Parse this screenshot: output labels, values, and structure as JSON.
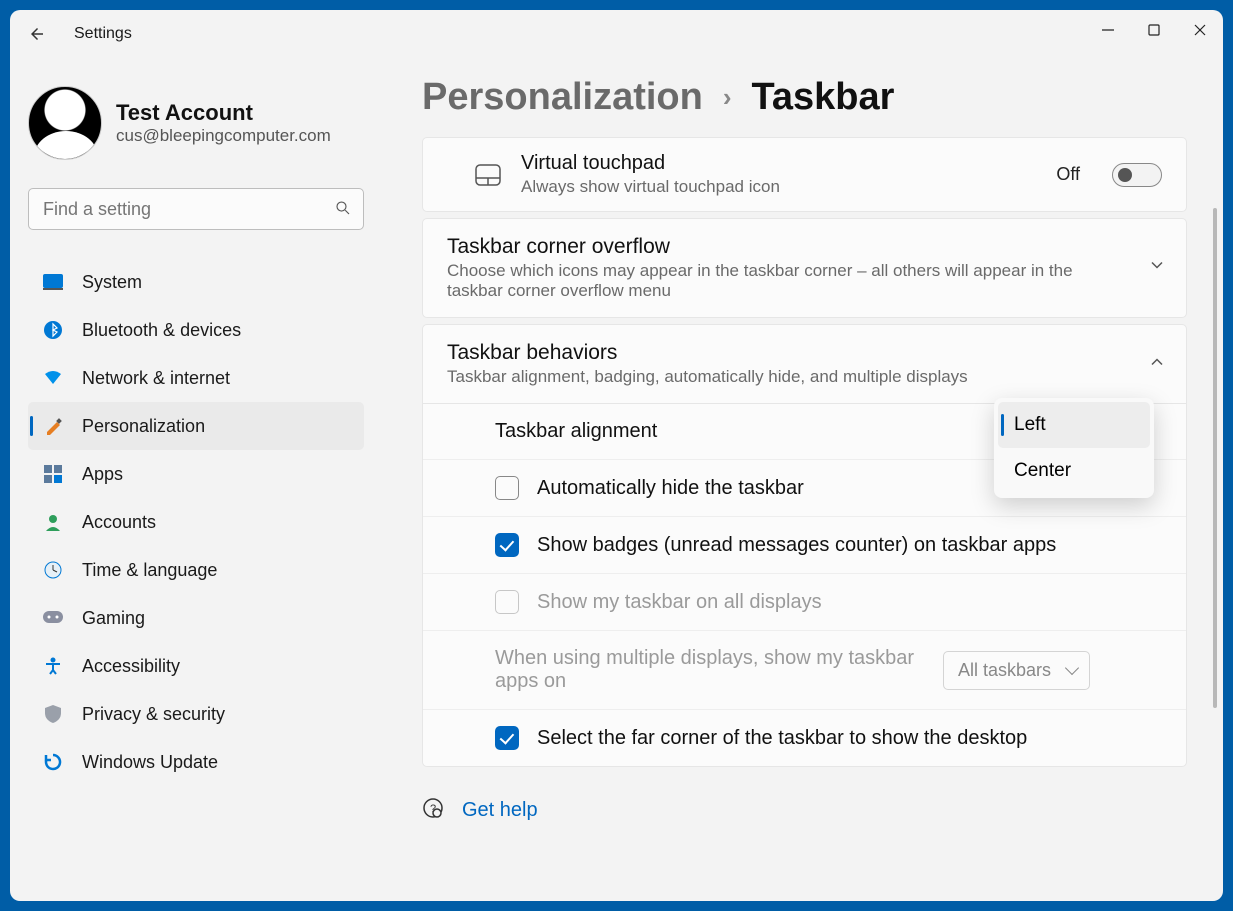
{
  "app": {
    "title": "Settings"
  },
  "window_controls": {
    "min": "—",
    "max": "▢",
    "close": "✕"
  },
  "user": {
    "name": "Test Account",
    "email": "cus@bleepingcomputer.com"
  },
  "search": {
    "placeholder": "Find a setting"
  },
  "nav": [
    {
      "label": "System",
      "icon": "system"
    },
    {
      "label": "Bluetooth & devices",
      "icon": "bluetooth"
    },
    {
      "label": "Network & internet",
      "icon": "network"
    },
    {
      "label": "Personalization",
      "icon": "personalization",
      "active": true
    },
    {
      "label": "Apps",
      "icon": "apps"
    },
    {
      "label": "Accounts",
      "icon": "accounts"
    },
    {
      "label": "Time & language",
      "icon": "time"
    },
    {
      "label": "Gaming",
      "icon": "gaming"
    },
    {
      "label": "Accessibility",
      "icon": "accessibility"
    },
    {
      "label": "Privacy & security",
      "icon": "privacy"
    },
    {
      "label": "Windows Update",
      "icon": "update"
    }
  ],
  "breadcrumb": {
    "parent": "Personalization",
    "chev": "›",
    "current": "Taskbar"
  },
  "rows": {
    "touchpad": {
      "title": "Virtual touchpad",
      "desc": "Always show virtual touchpad icon",
      "state_label": "Off",
      "on": false
    },
    "overflow": {
      "title": "Taskbar corner overflow",
      "desc": "Choose which icons may appear in the taskbar corner – all others will appear in the taskbar corner overflow menu",
      "expanded": false
    },
    "behaviors": {
      "title": "Taskbar behaviors",
      "desc": "Taskbar alignment, badging, automatically hide, and multiple displays",
      "expanded": true,
      "alignment_label": "Taskbar alignment",
      "alignment_options": [
        "Left",
        "Center"
      ],
      "alignment_selected": "Left",
      "autohide_label": "Automatically hide the taskbar",
      "autohide_checked": false,
      "badges_label": "Show badges (unread messages counter) on taskbar apps",
      "badges_checked": true,
      "alldisplays_label": "Show my taskbar on all displays",
      "alldisplays_checked": false,
      "alldisplays_disabled": true,
      "multidisplay_label": "When using multiple displays, show my taskbar apps on",
      "multidisplay_value": "All taskbars",
      "multidisplay_disabled": true,
      "farcorner_label": "Select the far corner of the taskbar to show the desktop",
      "farcorner_checked": true
    }
  },
  "help": {
    "label": "Get help"
  }
}
